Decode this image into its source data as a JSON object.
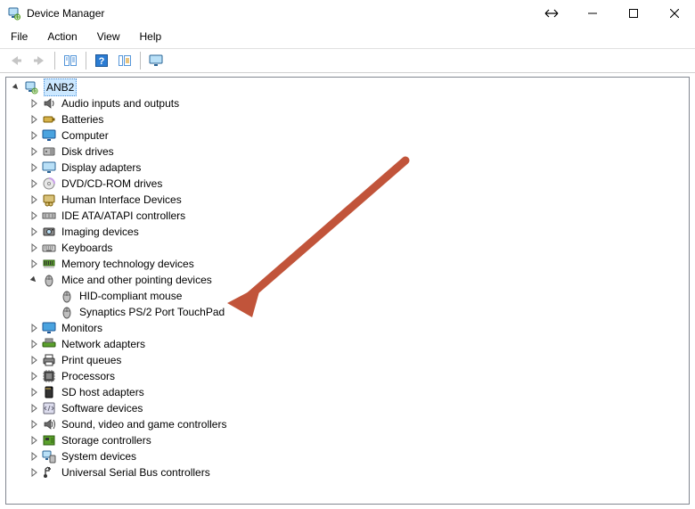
{
  "window": {
    "title": "Device Manager"
  },
  "menu": {
    "file": "File",
    "action": "Action",
    "view": "View",
    "help": "Help"
  },
  "tree": {
    "root": {
      "label": "ANB2",
      "icon": "computer"
    },
    "categories": [
      {
        "label": "Audio inputs and outputs",
        "icon": "speaker",
        "expanded": false
      },
      {
        "label": "Batteries",
        "icon": "battery",
        "expanded": false
      },
      {
        "label": "Computer",
        "icon": "computer-flat",
        "expanded": false
      },
      {
        "label": "Disk drives",
        "icon": "disk",
        "expanded": false
      },
      {
        "label": "Display adapters",
        "icon": "display",
        "expanded": false
      },
      {
        "label": "DVD/CD-ROM drives",
        "icon": "cdrom",
        "expanded": false
      },
      {
        "label": "Human Interface Devices",
        "icon": "hid",
        "expanded": false
      },
      {
        "label": "IDE ATA/ATAPI controllers",
        "icon": "ide",
        "expanded": false
      },
      {
        "label": "Imaging devices",
        "icon": "imaging",
        "expanded": false
      },
      {
        "label": "Keyboards",
        "icon": "keyboard",
        "expanded": false
      },
      {
        "label": "Memory technology devices",
        "icon": "memory",
        "expanded": false
      },
      {
        "label": "Mice and other pointing devices",
        "icon": "mouse",
        "expanded": true,
        "children": [
          {
            "label": "HID-compliant mouse",
            "icon": "mouse"
          },
          {
            "label": "Synaptics PS/2 Port TouchPad",
            "icon": "mouse"
          }
        ]
      },
      {
        "label": "Monitors",
        "icon": "monitor",
        "expanded": false
      },
      {
        "label": "Network adapters",
        "icon": "network",
        "expanded": false
      },
      {
        "label": "Print queues",
        "icon": "printer",
        "expanded": false
      },
      {
        "label": "Processors",
        "icon": "processor",
        "expanded": false
      },
      {
        "label": "SD host adapters",
        "icon": "sdhost",
        "expanded": false
      },
      {
        "label": "Software devices",
        "icon": "software",
        "expanded": false
      },
      {
        "label": "Sound, video and game controllers",
        "icon": "sound",
        "expanded": false
      },
      {
        "label": "Storage controllers",
        "icon": "storage",
        "expanded": false
      },
      {
        "label": "System devices",
        "icon": "system",
        "expanded": false
      },
      {
        "label": "Universal Serial Bus controllers",
        "icon": "usb",
        "expanded": false
      }
    ]
  }
}
